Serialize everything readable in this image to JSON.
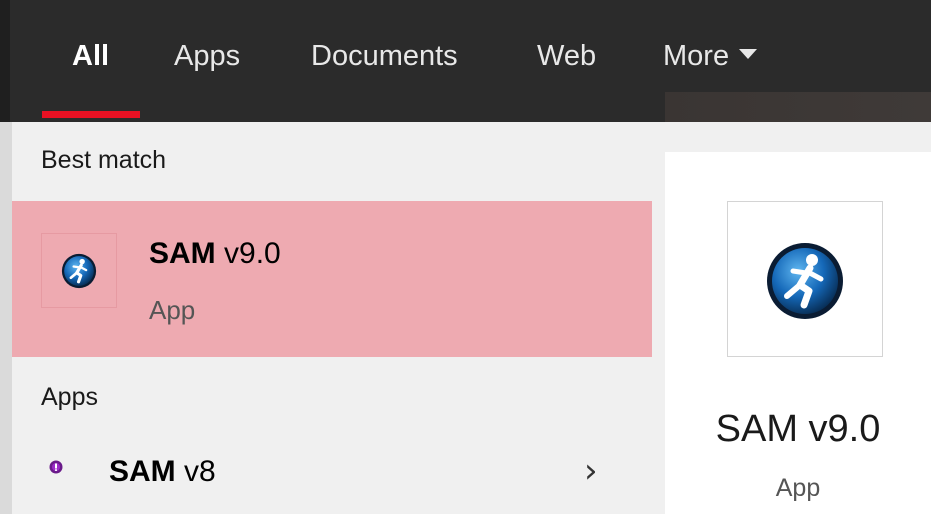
{
  "tabs": {
    "all": "All",
    "apps": "Apps",
    "documents": "Documents",
    "web": "Web",
    "more": "More"
  },
  "best_match": {
    "section_label": "Best match",
    "title_strong": "SAM",
    "title_rest": " v9.0",
    "subtitle": "App"
  },
  "apps_section": {
    "section_label": "Apps",
    "items": [
      {
        "title_strong": "SAM",
        "title_rest": " v8"
      }
    ]
  },
  "preview": {
    "title": "SAM v9.0",
    "subtitle": "App"
  },
  "colors": {
    "topbar": "#2b2b2b",
    "accent": "#e81123",
    "selection": "#eeaab1",
    "panel": "#f0f0f0",
    "card": "#ffffff"
  },
  "icons": {
    "best_match": "runner-icon",
    "v8": "sam-v8-icon",
    "more": "chevron-down-icon",
    "expand": "chevron-right-icon"
  }
}
